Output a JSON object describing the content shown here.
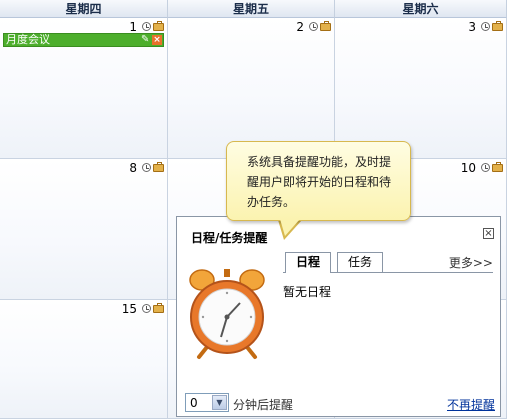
{
  "calendar": {
    "headers": [
      "星期四",
      "星期五",
      "星期六"
    ],
    "days": [
      "1",
      "2",
      "3",
      "8",
      "",
      "10",
      "15"
    ],
    "event": {
      "label": "月度会议",
      "color": "#4dae2c"
    }
  },
  "tooltip": {
    "line1": "系统具备提醒功能，及时提",
    "line2": "醒用户即将开始的日程和待",
    "line3": "办任务。"
  },
  "reminder": {
    "title": "日程/任务提醒",
    "close_label": "×",
    "tabs": [
      {
        "label": "日程",
        "active": true
      },
      {
        "label": "任务",
        "active": false
      }
    ],
    "more_label": "更多>>",
    "empty_text": "暂无日程",
    "minutes_value": "0",
    "minutes_suffix": "分钟后提醒",
    "stop_label": "不再提醒"
  }
}
